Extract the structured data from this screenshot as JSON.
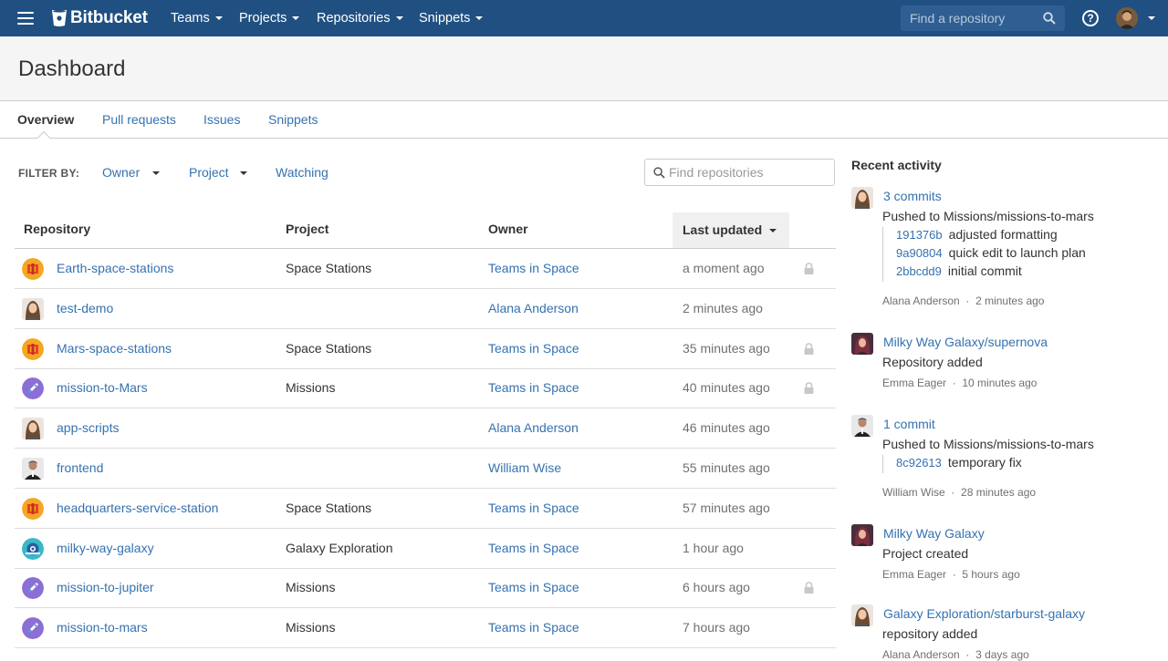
{
  "nav": {
    "brand": "Bitbucket",
    "menus": [
      "Teams",
      "Projects",
      "Repositories",
      "Snippets"
    ],
    "search_placeholder": "Find a repository",
    "help_label": "?"
  },
  "page": {
    "title": "Dashboard"
  },
  "tabs": [
    "Overview",
    "Pull requests",
    "Issues",
    "Snippets"
  ],
  "filter": {
    "label": "FILTER BY:",
    "owner": "Owner",
    "project": "Project",
    "watching": "Watching",
    "search_placeholder": "Find repositories"
  },
  "table": {
    "headers": {
      "repository": "Repository",
      "project": "Project",
      "owner": "Owner",
      "updated": "Last updated"
    },
    "rows": [
      {
        "name": "Earth-space-stations",
        "project": "Space Stations",
        "owner": "Teams in Space",
        "updated": "a moment ago",
        "avatar": "space-station-icon",
        "private": true
      },
      {
        "name": "test-demo",
        "project": "",
        "owner": "Alana Anderson",
        "updated": "2 minutes ago",
        "avatar": "user-avatar-alana",
        "private": false
      },
      {
        "name": "Mars-space-stations",
        "project": "Space Stations",
        "owner": "Teams in Space",
        "updated": "35 minutes ago",
        "avatar": "space-station-icon",
        "private": true
      },
      {
        "name": "mission-to-Mars",
        "project": "Missions",
        "owner": "Teams in Space",
        "updated": "40 minutes ago",
        "avatar": "rocket-icon",
        "private": true
      },
      {
        "name": "app-scripts",
        "project": "",
        "owner": "Alana Anderson",
        "updated": "46 minutes ago",
        "avatar": "user-avatar-alana",
        "private": false
      },
      {
        "name": "frontend",
        "project": "",
        "owner": "William Wise",
        "updated": "55 minutes ago",
        "avatar": "user-avatar-william",
        "private": false
      },
      {
        "name": "headquarters-service-station",
        "project": "Space Stations",
        "owner": "Teams in Space",
        "updated": "57 minutes ago",
        "avatar": "space-station-icon",
        "private": false
      },
      {
        "name": "milky-way-galaxy",
        "project": "Galaxy Exploration",
        "owner": "Teams in Space",
        "updated": "1 hour ago",
        "avatar": "galaxy-robot-icon",
        "private": false
      },
      {
        "name": "mission-to-jupiter",
        "project": "Missions",
        "owner": "Teams in Space",
        "updated": "6 hours ago",
        "avatar": "rocket-icon",
        "private": true
      },
      {
        "name": "mission-to-mars",
        "project": "Missions",
        "owner": "Teams in Space",
        "updated": "7 hours ago",
        "avatar": "rocket-icon",
        "private": false
      }
    ]
  },
  "activity": {
    "heading": "Recent activity",
    "items": [
      {
        "title": "3 commits",
        "desc": "Pushed to Missions/missions-to-mars",
        "user": "Alana Anderson",
        "time": "2 minutes ago",
        "commits": [
          {
            "hash": "191376b",
            "msg": "adjusted formatting"
          },
          {
            "hash": "9a90804",
            "msg": "quick edit to launch plan"
          },
          {
            "hash": "2bbcdd9",
            "msg": "initial commit"
          }
        ]
      },
      {
        "title": "Milky Way Galaxy/supernova",
        "desc": "Repository added",
        "user": "Emma Eager",
        "time": "10 minutes ago",
        "commits": []
      },
      {
        "title": "1 commit",
        "desc": "Pushed to Missions/missions-to-mars",
        "user": "William Wise",
        "time": "28 minutes ago",
        "commits": [
          {
            "hash": "8c92613",
            "msg": "temporary fix"
          }
        ]
      },
      {
        "title": "Milky Way Galaxy",
        "desc": "Project created",
        "user": "Emma Eager",
        "time": "5 hours ago",
        "commits": []
      },
      {
        "title": "Galaxy Exploration/starburst-galaxy",
        "desc": "repository added",
        "user": "Alana Anderson",
        "time": "3 days ago",
        "commits": []
      }
    ]
  },
  "colors": {
    "nav_bg": "#205081",
    "link": "#3572b0",
    "station_orange": "#f5a623",
    "rocket_purple": "#8b6fd6",
    "galaxy_teal": "#3ab7c9"
  }
}
